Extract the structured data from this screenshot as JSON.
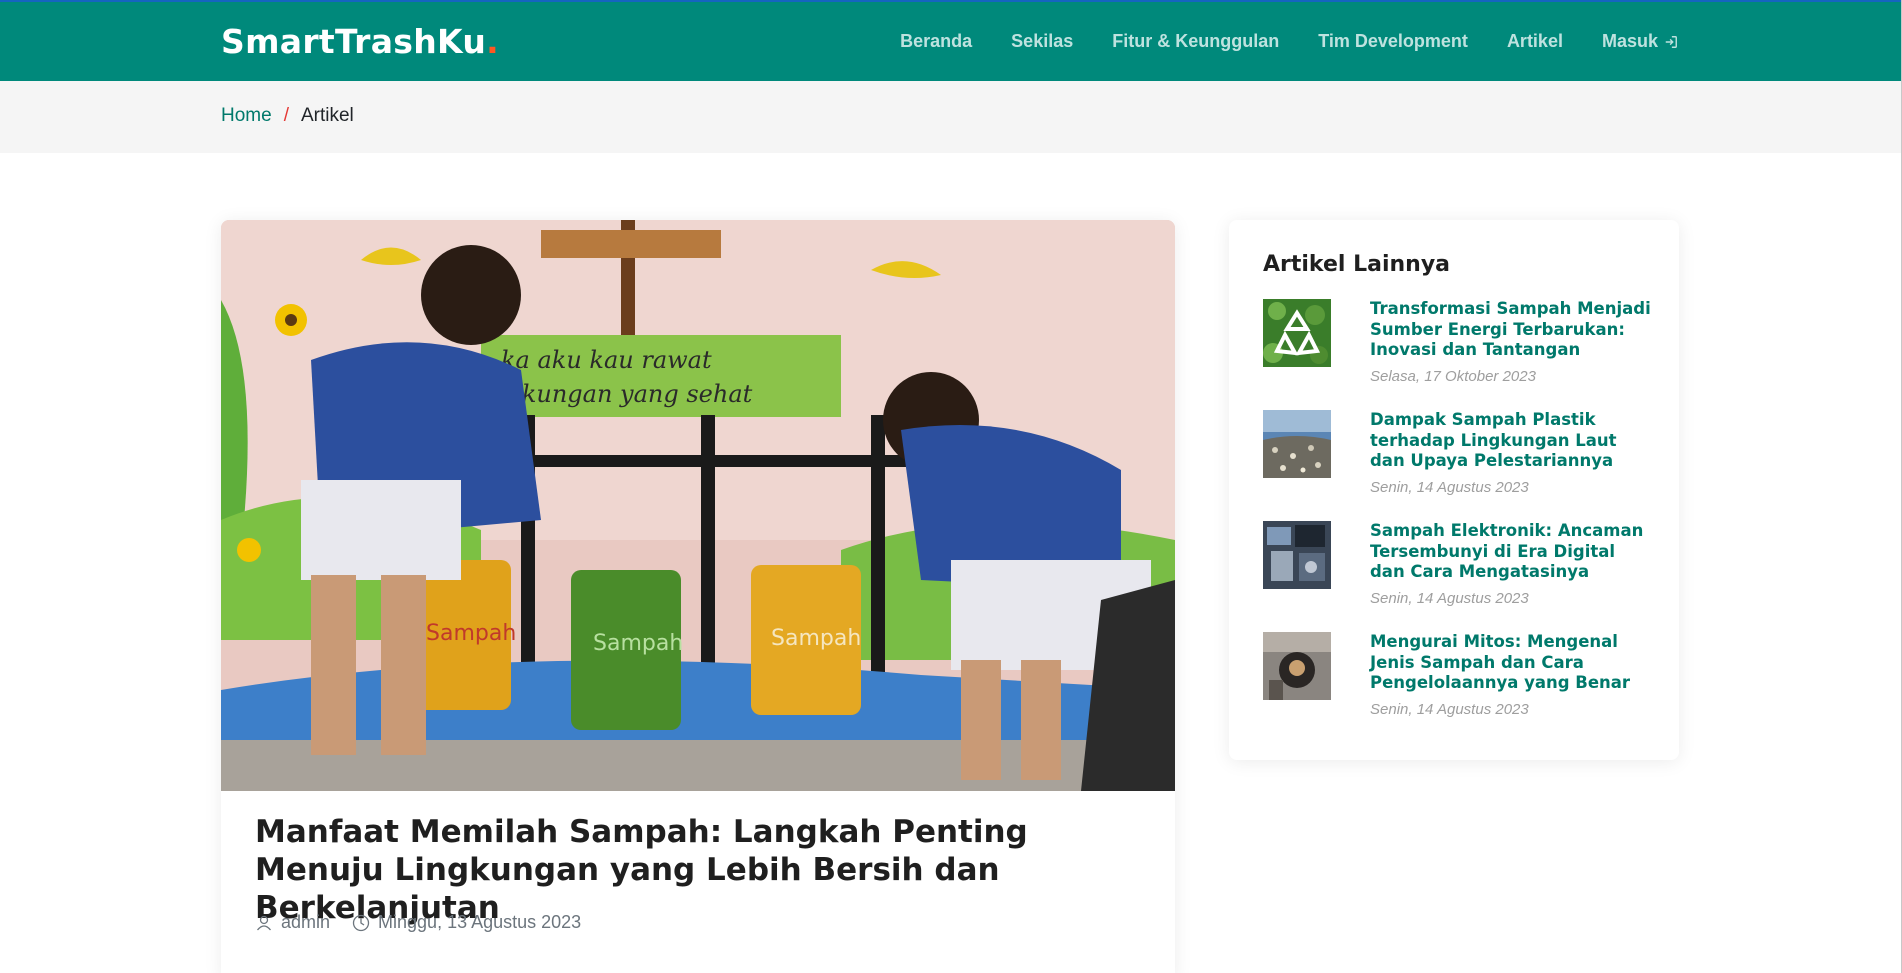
{
  "brand": {
    "name": "SmartTrashKu",
    "dot": "."
  },
  "nav": {
    "items": [
      {
        "label": "Beranda"
      },
      {
        "label": "Sekilas"
      },
      {
        "label": "Fitur & Keunggulan"
      },
      {
        "label": "Tim Development"
      },
      {
        "label": "Artikel"
      },
      {
        "label": "Masuk",
        "icon": "login-icon"
      }
    ]
  },
  "breadcrumb": {
    "home": "Home",
    "separator": "/",
    "current": "Artikel"
  },
  "article": {
    "image_icon": "article-photo",
    "title": "Manfaat Memilah Sampah: Langkah Penting Menuju Lingkungan yang Lebih Bersih dan Berkelanjutan",
    "author": "admin",
    "author_icon": "user-icon",
    "date": "Minggu, 13 Agustus 2023",
    "date_icon": "clock-icon"
  },
  "sidebar": {
    "title": "Artikel Lainnya",
    "posts": [
      {
        "title": "Transformasi Sampah Menjadi Sumber Energi Terbarukan: Inovasi dan Tantangan",
        "date": "Selasa, 17 Oktober 2023"
      },
      {
        "title": "Dampak Sampah Plastik terhadap Lingkungan Laut dan Upaya Pelestariannya",
        "date": "Senin, 14 Agustus 2023"
      },
      {
        "title": "Sampah Elektronik: Ancaman Tersembunyi di Era Digital dan Cara Mengatasinya",
        "date": "Senin, 14 Agustus 2023"
      },
      {
        "title": "Mengurai Mitos: Mengenal Jenis Sampah dan Cara Pengelolaannya yang Benar",
        "date": "Senin, 14 Agustus 2023"
      }
    ]
  },
  "colors": {
    "brand": "#00897b",
    "accent": "#ff5722",
    "link": "#00796b",
    "separator": "#e53935"
  }
}
